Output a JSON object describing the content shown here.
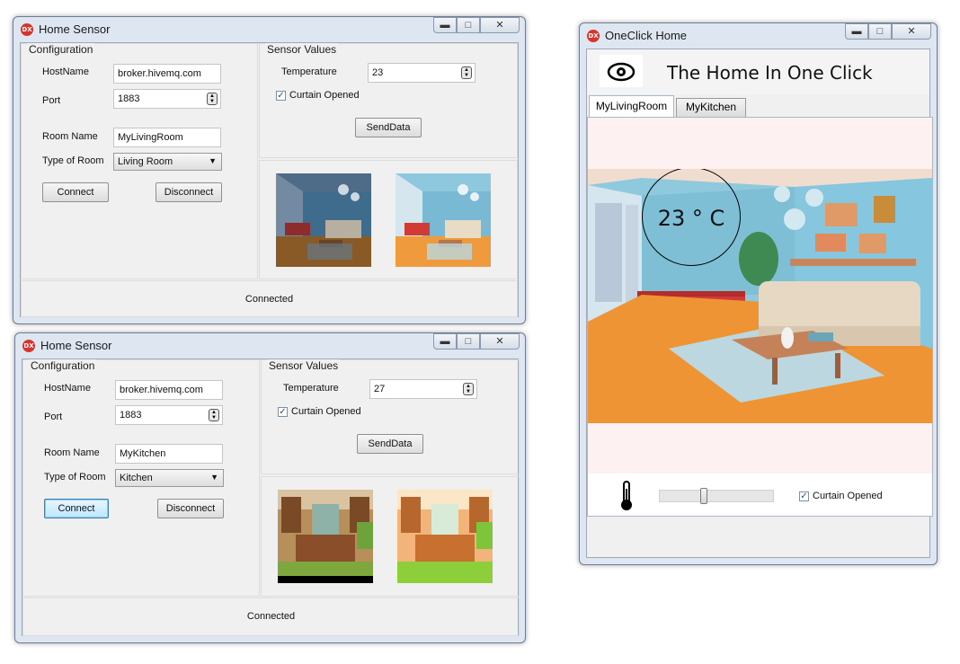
{
  "app_icon": "DX",
  "sensor1": {
    "title": "Home Sensor",
    "config_label": "Configuration",
    "hostname_label": "HostName",
    "hostname_value": "broker.hivemq.com",
    "port_label": "Port",
    "port_value": "1883",
    "room_name_label": "Room Name",
    "room_name_value": "MyLivingRoom",
    "type_label": "Type of Room",
    "type_value": "Living Room",
    "connect_label": "Connect",
    "disconnect_label": "Disconnect",
    "sensor_values_label": "Sensor Values",
    "temperature_label": "Temperature",
    "temperature_value": "23",
    "curtain_label": "Curtain Opened",
    "curtain_checked": true,
    "send_label": "SendData",
    "status": "Connected"
  },
  "sensor2": {
    "title": "Home Sensor",
    "config_label": "Configuration",
    "hostname_label": "HostName",
    "hostname_value": "broker.hivemq.com",
    "port_label": "Port",
    "port_value": "1883",
    "room_name_label": "Room Name",
    "room_name_value": "MyKitchen",
    "type_label": "Type of Room",
    "type_value": "Kitchen",
    "connect_label": "Connect",
    "disconnect_label": "Disconnect",
    "sensor_values_label": "Sensor Values",
    "temperature_label": "Temperature",
    "temperature_value": "27",
    "curtain_label": "Curtain Opened",
    "curtain_checked": true,
    "send_label": "SendData",
    "status": "Connected"
  },
  "oneclick": {
    "title": "OneClick Home",
    "heading": "The Home In One Click",
    "tabs": [
      "MyLivingRoom",
      "MyKitchen"
    ],
    "active_tab": "MyLivingRoom",
    "temperature_display": "23 ° C",
    "slider_level": 0.38,
    "curtain_label": "Curtain Opened",
    "curtain_checked": true
  }
}
